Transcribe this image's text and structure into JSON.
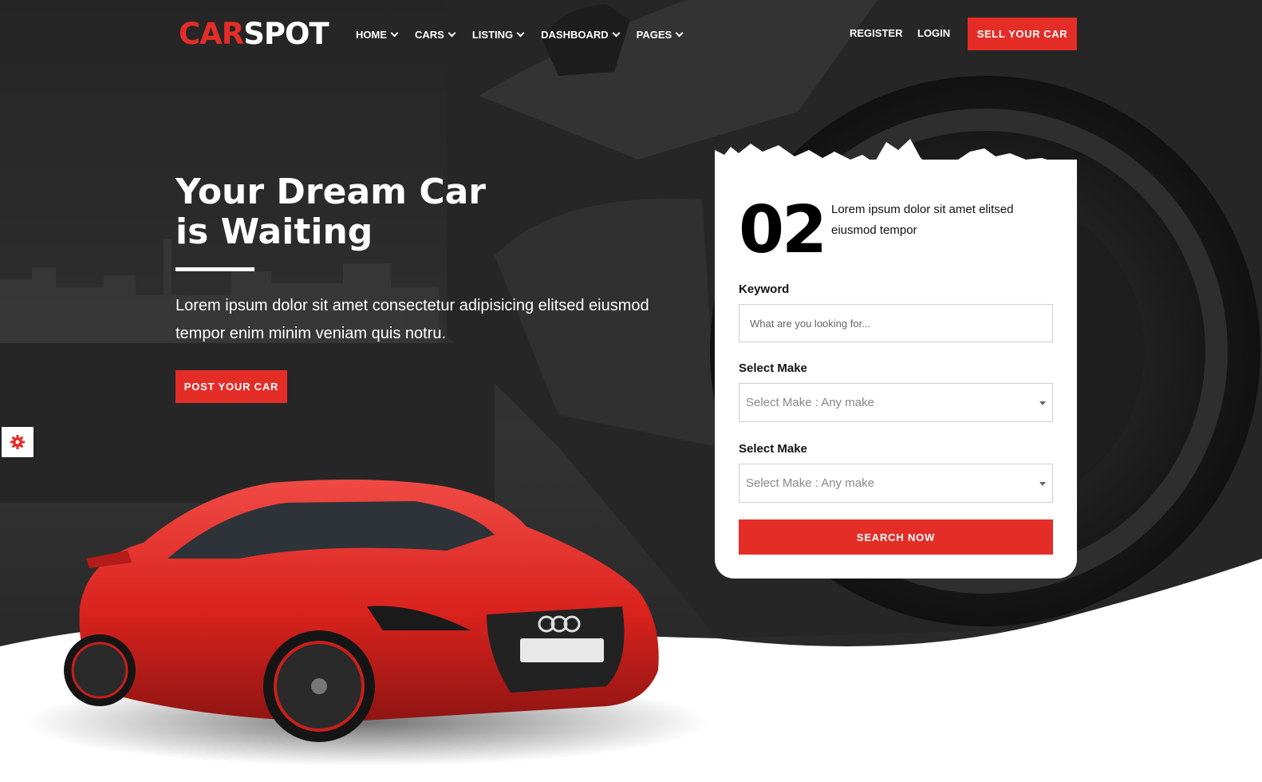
{
  "brand": {
    "logo_red": "CAR",
    "logo_white": "SPOT"
  },
  "nav": {
    "items": [
      "HOME",
      "CARS",
      "LISTING",
      "DASHBOARD",
      "PAGES"
    ],
    "register": "REGISTER",
    "login": "LOGIN",
    "sell_button": "SELL YOUR CAR"
  },
  "hero": {
    "title_line1": "Your Dream Car",
    "title_line2": "is Waiting",
    "subtitle": "Lorem ipsum dolor sit amet consectetur adipisicing elitsed eiusmod tempor enim minim veniam quis notru.",
    "post_button": "POST YOUR CAR",
    "settings_icon": "gear-icon"
  },
  "search_card": {
    "number": "02",
    "description": "Lorem ipsum dolor sit amet elitsed eiusmod tempor",
    "keyword_label": "Keyword",
    "keyword_placeholder": "What are you looking for...",
    "make_label_1": "Select Make",
    "make_value_1": "Select Make : Any make",
    "make_label_2": "Select Make",
    "make_value_2": "Select Make : Any make",
    "search_button": "SEARCH NOW"
  },
  "colors": {
    "accent": "#e52d27",
    "dark_bg": "#2b2b2b",
    "white": "#ffffff"
  }
}
